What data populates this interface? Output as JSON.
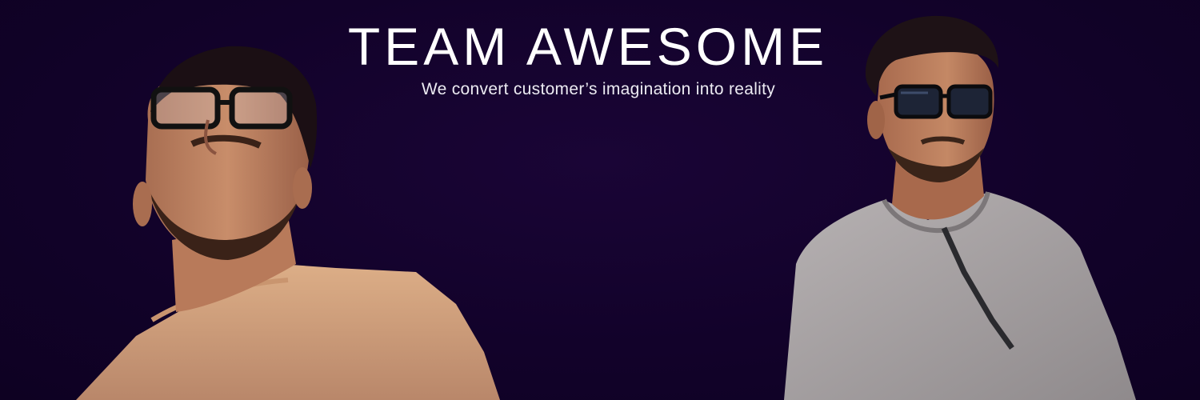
{
  "banner": {
    "title": "TEAM AWESOME",
    "subtitle": "We convert customer’s imagination into reality"
  },
  "photos": [
    {
      "icon": "person-with-glasses-looking-up-photo"
    },
    {
      "icon": "person-with-sunglasses-photo"
    }
  ],
  "colors": {
    "background": "#12022a",
    "title_text": "#ffffff",
    "subtitle_text": "#ecebf2",
    "left_shirt": "#d8a982",
    "right_shirt": "#a8a4a6",
    "skin_left": "#c18563",
    "skin_right": "#b57858",
    "hair": "#1a0e12"
  }
}
